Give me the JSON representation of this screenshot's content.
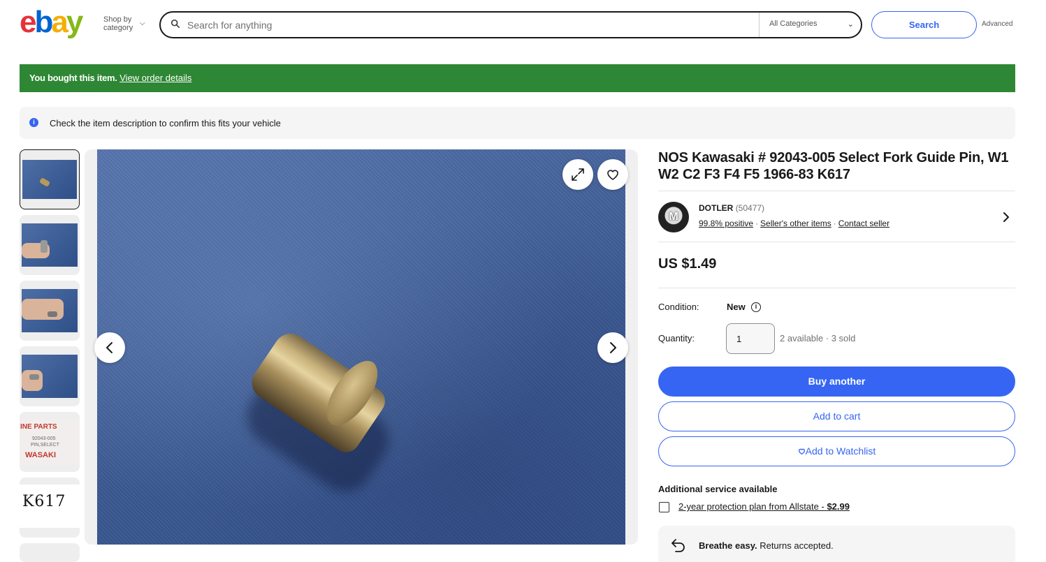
{
  "header": {
    "logo_text": "ebay",
    "shop_by_line1": "Shop by",
    "shop_by_line2": "category",
    "search_placeholder": "Search for anything",
    "category_selected": "All Categories",
    "search_button": "Search",
    "advanced_link": "Advanced"
  },
  "banners": {
    "bought_strong": "You bought this item.",
    "bought_link": "View order details",
    "fit_message": "Check the item description to confirm this fits your vehicle"
  },
  "thumbnails": [
    {
      "alt": "pin on blue cloth",
      "selected": true
    },
    {
      "alt": "pin held in fingers"
    },
    {
      "alt": "pin held in fingers 2"
    },
    {
      "alt": "pin with part bag"
    },
    {
      "alt": "genuine parts label"
    },
    {
      "alt": "K617 tag"
    }
  ],
  "thumb_labels": {
    "genuine": "INE PARTS",
    "part_num": "92043-005",
    "pin_select": "PIN,SELECT",
    "brand": "WASAKI",
    "k617": "K617"
  },
  "item": {
    "title": "NOS Kawasaki # 92043-005 Select Fork Guide Pin, W1 W2 C2 F3 F4 F5 1966-83 K617",
    "seller_name": "DOTLER",
    "seller_feedback": "(50477)",
    "seller_positive": "99.8% positive",
    "seller_other_items": "Seller's other items",
    "contact_seller": "Contact seller",
    "price": "US $1.49",
    "condition_label": "Condition:",
    "condition_value": "New",
    "quantity_label": "Quantity:",
    "quantity_value": "1",
    "availability": "2 available · 3 sold",
    "buy_button": "Buy another",
    "cart_button": "Add to cart",
    "watch_button": "Add to Watchlist",
    "additional_service": "Additional service available",
    "protection_plan": "2-year protection plan from Allstate - ",
    "protection_price": "$2.99",
    "breathe_strong": "Breathe easy.",
    "breathe_text": " Returns accepted."
  },
  "colors": {
    "ebay_blue": "#3665f3",
    "bought_green": "#2e8734",
    "logo_e": "#e53238",
    "logo_b": "#0064d2",
    "logo_a": "#f5af02",
    "logo_y": "#86b817"
  },
  "icons": [
    "search-icon",
    "chevron-down-icon",
    "info-icon",
    "expand-icon",
    "heart-icon",
    "chevron-left-icon",
    "chevron-right-icon",
    "return-icon"
  ]
}
